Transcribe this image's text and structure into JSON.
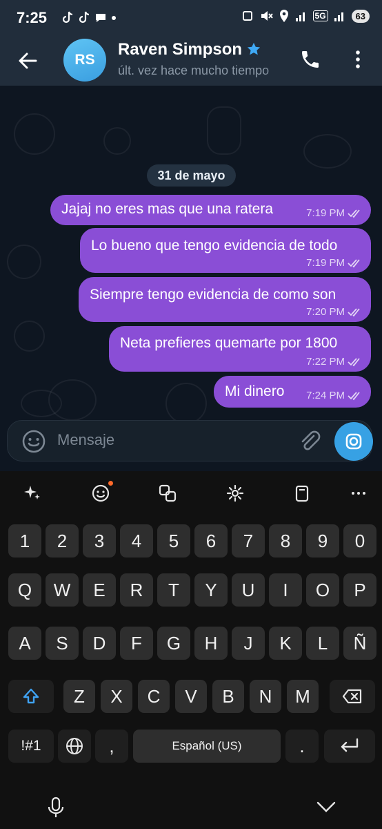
{
  "status_bar": {
    "time": "7:25",
    "network": "5G",
    "battery": "63"
  },
  "header": {
    "avatar_initials": "RS",
    "name": "Raven Simpson",
    "status": "últ. vez hace mucho tiempo"
  },
  "chat": {
    "date": "31 de mayo",
    "messages": [
      {
        "text": "Jajaj no eres mas que una ratera",
        "time": "7:19 PM"
      },
      {
        "text": "Lo bueno que tengo evidencia de todo",
        "time": "7:19 PM"
      },
      {
        "text": "Siempre tengo evidencia de como son",
        "time": "7:20 PM"
      },
      {
        "text": "Neta prefieres quemarte por 1800",
        "time": "7:22 PM"
      },
      {
        "text": "Mi dinero",
        "time": "7:24 PM"
      }
    ]
  },
  "input": {
    "placeholder": "Mensaje"
  },
  "keyboard": {
    "row_numbers": [
      "1",
      "2",
      "3",
      "4",
      "5",
      "6",
      "7",
      "8",
      "9",
      "0"
    ],
    "row_1": [
      "Q",
      "W",
      "E",
      "R",
      "T",
      "Y",
      "U",
      "I",
      "O",
      "P"
    ],
    "row_2": [
      "A",
      "S",
      "D",
      "F",
      "G",
      "H",
      "J",
      "K",
      "L",
      "Ñ"
    ],
    "row_3": [
      "Z",
      "X",
      "C",
      "V",
      "B",
      "N",
      "M"
    ],
    "symbols_label": "!#1",
    "comma": ",",
    "space_label": "Español (US)",
    "period": "."
  },
  "colors": {
    "header_bg": "#212d3b",
    "chat_bg": "#0e1621",
    "bubble_out": "#8a4ed6",
    "accent": "#37a1e4",
    "key_bg": "#2e2e2e"
  }
}
